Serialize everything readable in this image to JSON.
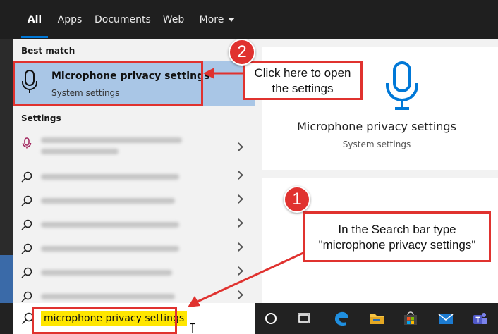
{
  "tabs": [
    {
      "label": "All",
      "active": true
    },
    {
      "label": "Apps"
    },
    {
      "label": "Documents"
    },
    {
      "label": "Web"
    },
    {
      "label": "More"
    }
  ],
  "best_match": {
    "header": "Best match",
    "title": "Microphone privacy settings",
    "subtitle": "System settings",
    "icon": "microphone-icon"
  },
  "settings_section": {
    "header": "Settings",
    "rows": [
      {
        "icon": "microphone-icon",
        "text_blurred": true
      },
      {
        "icon": "search-icon",
        "text_blurred": true
      },
      {
        "icon": "search-icon",
        "text_blurred": true
      },
      {
        "icon": "search-icon",
        "text_blurred": true
      },
      {
        "icon": "search-icon",
        "text_blurred": true
      },
      {
        "icon": "search-icon",
        "text_blurred": true
      },
      {
        "icon": "search-icon",
        "text_blurred": true
      }
    ]
  },
  "detail": {
    "title": "Microphone privacy settings",
    "subtitle": "System settings",
    "icon": "microphone-icon"
  },
  "search": {
    "value": "microphone privacy settings",
    "icon": "search-icon"
  },
  "taskbar_icons": [
    "cortana-icon",
    "task-view-icon",
    "edge-icon",
    "file-explorer-icon",
    "store-icon",
    "mail-icon",
    "teams-icon"
  ],
  "annotations": {
    "step1": {
      "number": "1",
      "text_line1": "In the Search bar type",
      "text_line2": "\"microphone privacy settings\""
    },
    "step2": {
      "number": "2",
      "text_line1": "Click here to open",
      "text_line2": "the settings"
    }
  },
  "colors": {
    "accent": "#0078d7",
    "annotation": "#e0322f",
    "highlight": "#ffe600",
    "selected": "#a9c6e6"
  }
}
